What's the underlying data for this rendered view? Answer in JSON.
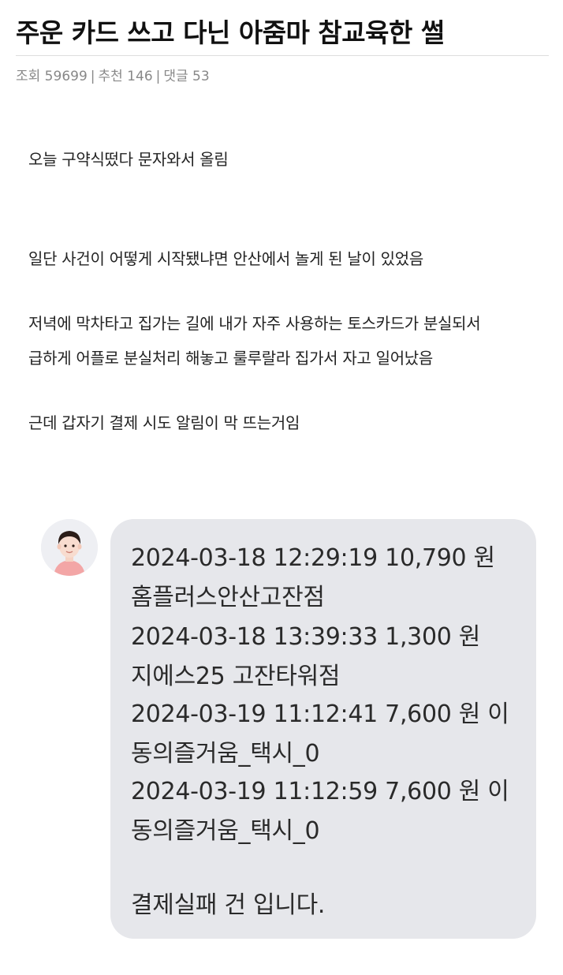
{
  "post": {
    "title": "주운 카드 쓰고 다닌 아줌마 참교육한 썰",
    "meta": {
      "views": "조회 59699",
      "recommends": "추천 146",
      "comments": "댓글 53"
    },
    "body_lines": [
      "오늘 구약식떴다 문자와서 올림",
      "일단 사건이 어떻게 시작됐냐면 안산에서 놀게 된 날이 있었음",
      "저녁에 막차타고 집가는 길에 내가 자주 사용하는 토스카드가 분실되서",
      "급하게 어플로 분실처리 해놓고 룰루랄라 집가서 자고 일어났음",
      "근데 갑자기 결제 시도 알림이 막 뜨는거임"
    ]
  },
  "message": {
    "avatar_icon": "person-avatar-icon",
    "lines": [
      "2024-03-18 12:29:19 10,790 원",
      "홈플러스안산고잔점",
      "2024-03-18 13:39:33 1,300 원",
      "지에스25 고잔타워점",
      "2024-03-19 11:12:41 7,600 원 이",
      "동의즐거움_택시_0",
      "2024-03-19 11:12:59 7,600 원 이",
      "동의즐거움_택시_0",
      "결제실패 건 입니다."
    ]
  }
}
